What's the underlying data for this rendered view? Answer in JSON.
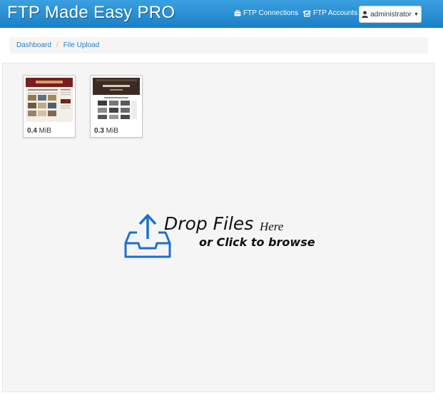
{
  "navbar": {
    "brand": "FTP Made Easy PRO",
    "ftp_connections": {
      "label": "FTP Connections",
      "icon": "briefcase-icon"
    },
    "ftp_accounts": {
      "label": "FTP Accounts",
      "icon": "check-square-icon"
    },
    "user_menu": {
      "label": "administrator",
      "icon": "user-icon"
    },
    "colors": {
      "navbar": "#1c80c8",
      "brand_text": "#ffffff"
    }
  },
  "breadcrumb": {
    "items": [
      "Dashboard",
      "File Upload"
    ],
    "separator": "/"
  },
  "dropzone": {
    "files": [
      {
        "size_value": "0.4",
        "size_unit": " MiB"
      },
      {
        "size_value": "0.3",
        "size_unit": " MiB"
      }
    ],
    "title": "Drop Files",
    "title_suffix": "Here",
    "subtitle": "or Click to browse",
    "icon": "inbox-upload-icon",
    "icon_color": "#1a6fd0"
  }
}
